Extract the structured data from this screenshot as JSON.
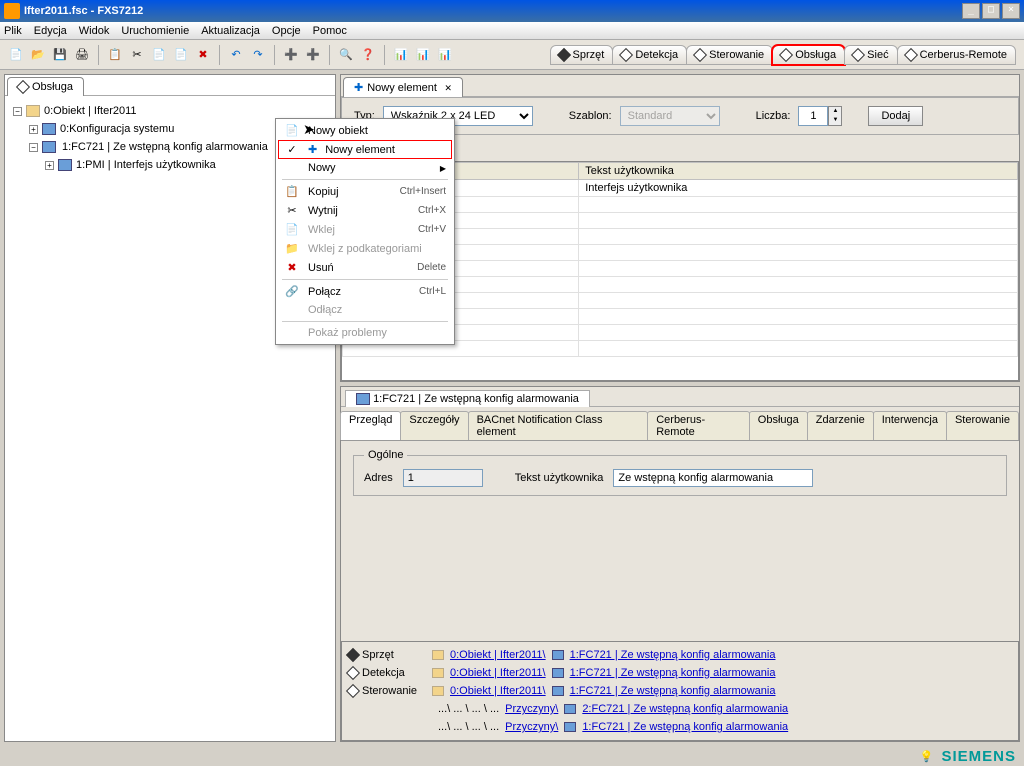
{
  "window": {
    "title": "Ifter2011.fsc - FXS7212",
    "min": "_",
    "max": "□",
    "close": "×"
  },
  "menu": [
    "Plik",
    "Edycja",
    "Widok",
    "Uruchomienie",
    "Aktualizacja",
    "Opcje",
    "Pomoc"
  ],
  "rightTabs": {
    "sprzet": "Sprzęt",
    "detekcja": "Detekcja",
    "sterowanie": "Sterowanie",
    "obsluga": "Obsługa",
    "siec": "Sieć",
    "cerberus": "Cerberus-Remote"
  },
  "sidebarTab": "Obsługa",
  "tree": {
    "root": "0:Obiekt | Ifter2011",
    "konfig": "0:Konfiguracja systemu",
    "fc721": "1:FC721 | Ze wstępną konfig alarmowania",
    "pmi": "1:PMI | Interfejs użytkownika"
  },
  "contentTab": "Nowy element",
  "form": {
    "typLabel": "Typ:",
    "typValue": "Wskaźnik 2 x 24 LED",
    "szablonLabel": "Szablon:",
    "szablonValue": "Standard",
    "liczbaLabel": "Liczba:",
    "liczbaValue": "1",
    "dodaj": "Dodaj"
  },
  "tableHeaders": {
    "blank": " ",
    "tekst": "Tekst użytkownika"
  },
  "tableRows": [
    {
      "c1": "...",
      "c2": "Interfejs użytkownika"
    }
  ],
  "ctx": {
    "nowyObiekt": "Nowy obiekt",
    "nowyElement": "Nowy element",
    "nowy": "Nowy",
    "kopiuj": "Kopiuj",
    "kopiujSc": "Ctrl+Insert",
    "wytnij": "Wytnij",
    "wytnijSc": "Ctrl+X",
    "wklej": "Wklej",
    "wklejSc": "Ctrl+V",
    "wklejPod": "Wklej z podkategoriami",
    "usun": "Usuń",
    "usunSc": "Delete",
    "polacz": "Połącz",
    "polaczSc": "Ctrl+L",
    "odlacz": "Odłącz",
    "pokaz": "Pokaż problemy"
  },
  "details": {
    "title": "1:FC721 | Ze wstępną konfig alarmowania",
    "tabs": [
      "Przegląd",
      "Szczegóły",
      "BACnet Notification Class element",
      "Cerberus-Remote",
      "Obsługa",
      "Zdarzenie",
      "Interwencja",
      "Sterowanie"
    ],
    "legend": "Ogólne",
    "adresLbl": "Adres",
    "adresVal": "1",
    "tekstLbl": "Tekst użytkownika",
    "tekstVal": "Ze wstępną konfig alarmowania"
  },
  "bc": {
    "sprzet": "Sprzęt",
    "detekcja": "Detekcja",
    "sterowanie": "Sterowanie",
    "obj": "0:Obiekt | Ifter2011\\",
    "fc721": "1:FC721 | Ze wstępną konfig alarmowania",
    "przyczyna": "Przyczyny\\",
    "fc721_2": "2:FC721 | Ze wstępną konfig alarmowania",
    "fc721_1": "1:FC721 | Ze wstępną konfig alarmowania"
  },
  "brand": "SIEMENS"
}
